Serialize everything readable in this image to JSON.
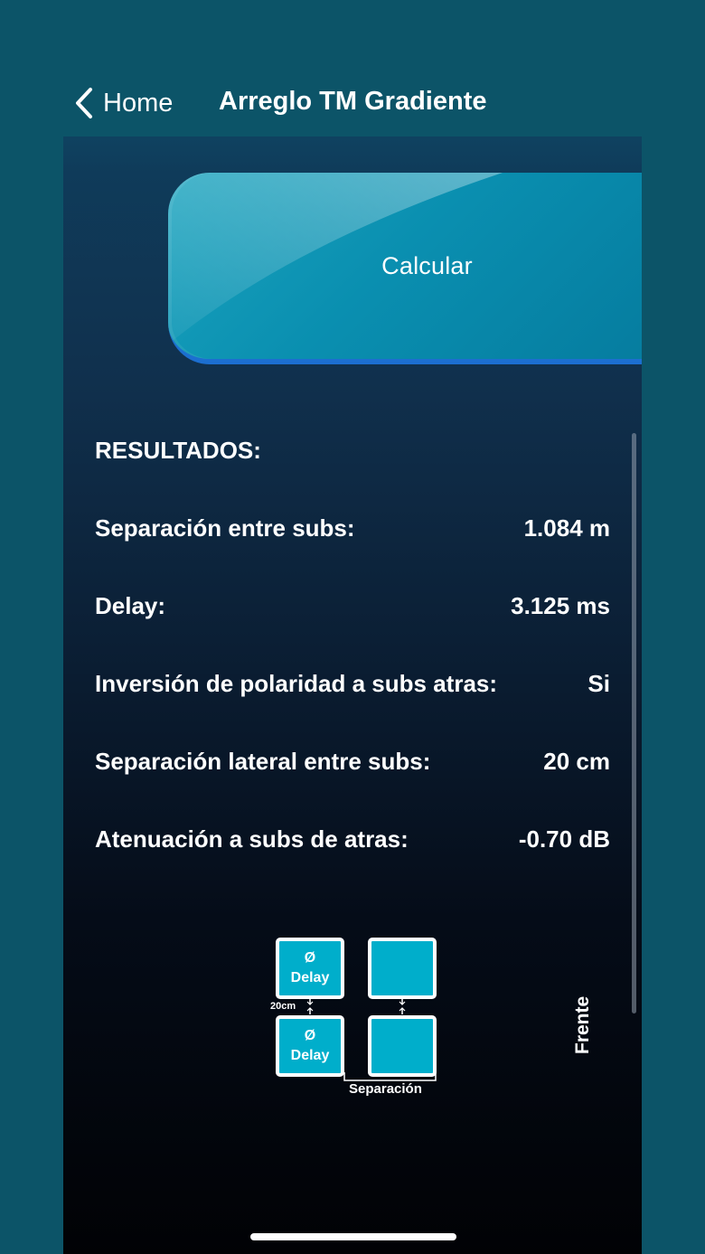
{
  "nav": {
    "back_label": "Home",
    "title": "Arreglo TM Gradiente"
  },
  "calculate_button": {
    "label": "Calcular"
  },
  "results": {
    "title": "RESULTADOS:",
    "rows": [
      {
        "label": "Separación entre subs:",
        "value": "1.084 m"
      },
      {
        "label": "Delay:",
        "value": "3.125 ms"
      },
      {
        "label": "Inversión de polaridad a subs atras:",
        "value": "Si"
      },
      {
        "label": "Separación lateral entre subs:",
        "value": "20 cm"
      },
      {
        "label": "Atenuación a subs de atras:",
        "value": "-0.70 dB"
      }
    ]
  },
  "diagram": {
    "phase_symbol": "Ø",
    "delay_label": "Delay",
    "lateral_spacing_label": "20cm",
    "separation_label": "Separación",
    "front_label": "Frente"
  },
  "colors": {
    "background": "#0c5468",
    "sub_box": "#00aecb",
    "button_underline": "#1c6fd0"
  },
  "icons": {
    "back": "chevron-left-icon"
  }
}
